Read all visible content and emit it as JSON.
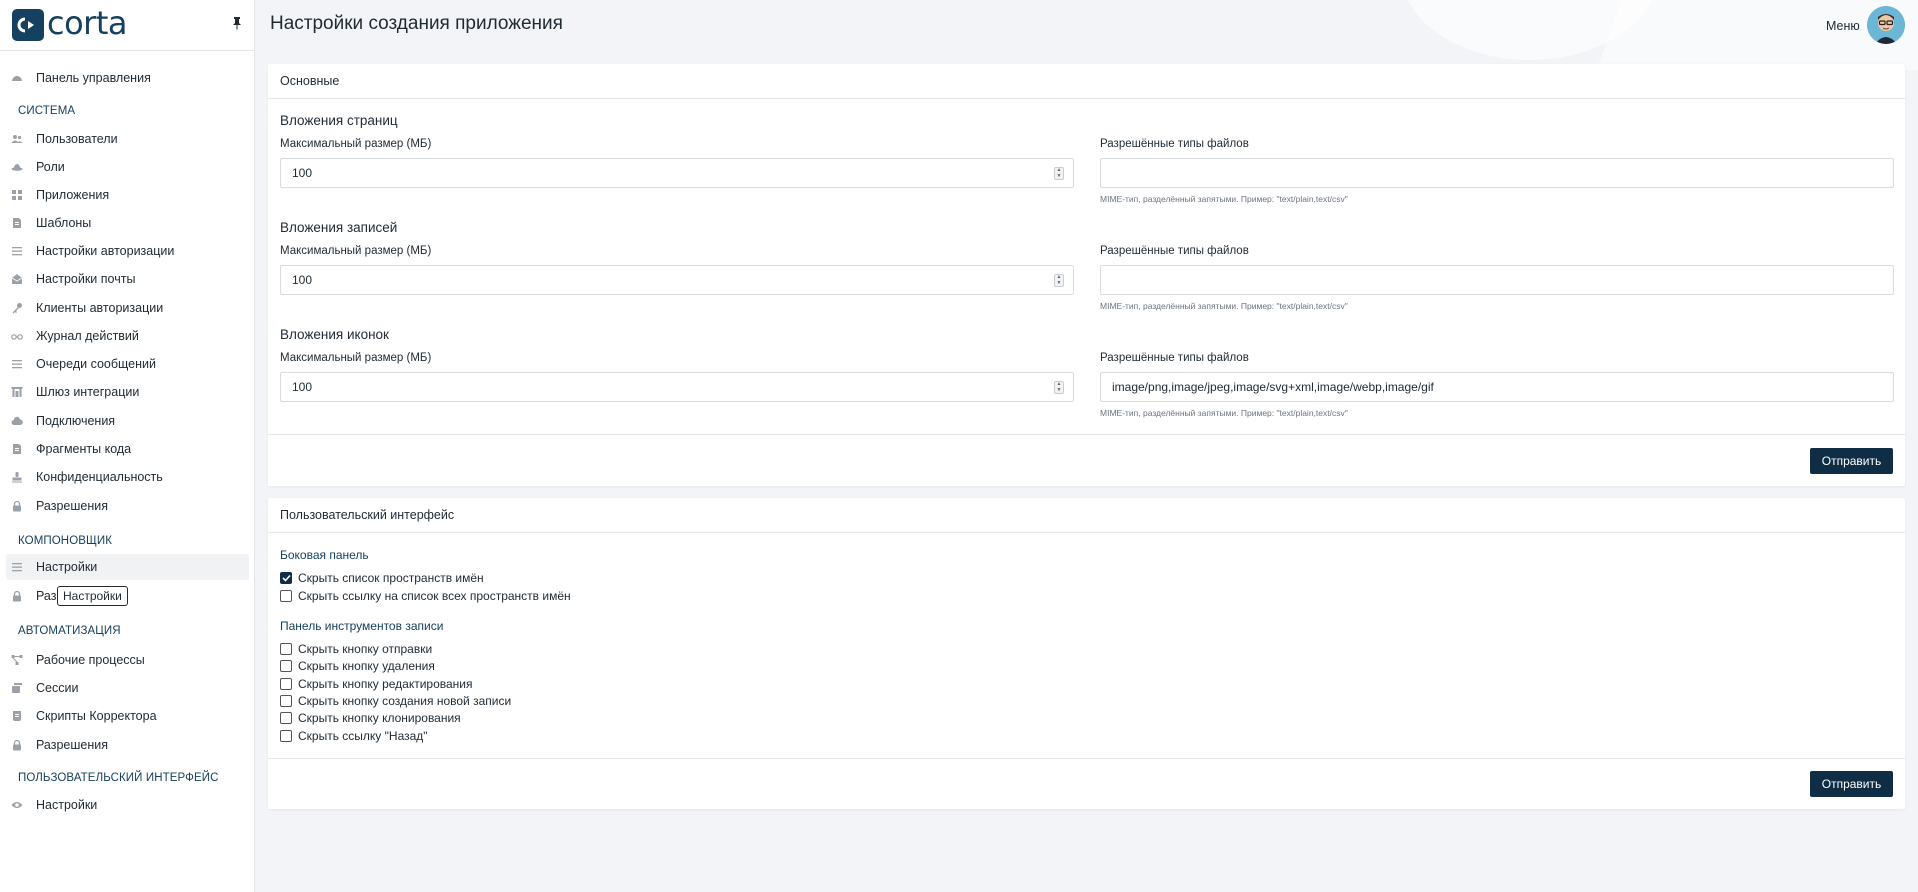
{
  "brand": {
    "name": "corta"
  },
  "header": {
    "title": "Настройки создания приложения",
    "menu_label": "Меню"
  },
  "sidebar": {
    "items": [
      {
        "label": "Панель управления",
        "icon": "dashboard-icon"
      },
      {
        "section": "СИСТЕМА"
      },
      {
        "label": "Пользователи",
        "icon": "users-icon"
      },
      {
        "label": "Роли",
        "icon": "role-icon"
      },
      {
        "label": "Приложения",
        "icon": "grid-icon"
      },
      {
        "label": "Шаблоны",
        "icon": "template-icon"
      },
      {
        "label": "Настройки авторизации",
        "icon": "list-icon"
      },
      {
        "label": "Настройки почты",
        "icon": "mail-icon"
      },
      {
        "label": "Клиенты авторизации",
        "icon": "key-icon"
      },
      {
        "label": "Журнал действий",
        "icon": "glasses-icon"
      },
      {
        "label": "Очереди сообщений",
        "icon": "queue-icon"
      },
      {
        "label": "Шлюз интеграции",
        "icon": "gateway-icon"
      },
      {
        "label": "Подключения",
        "icon": "cloud-icon"
      },
      {
        "label": "Фрагменты кода",
        "icon": "code-file-icon"
      },
      {
        "label": "Конфиденциальность",
        "icon": "stamp-icon"
      },
      {
        "label": "Разрешения",
        "icon": "lock-icon"
      },
      {
        "section": "КОМПОНОВЩИК"
      },
      {
        "label": "Настройки",
        "icon": "list-icon"
      },
      {
        "label": "Разр",
        "icon": "lock-icon"
      },
      {
        "section": "АВТОМАТИЗАЦИЯ"
      },
      {
        "label": "Рабочие процессы",
        "icon": "workflow-icon"
      },
      {
        "label": "Сессии",
        "icon": "session-icon"
      },
      {
        "label": "Скрипты Корректора",
        "icon": "script-icon"
      },
      {
        "label": "Разрешения",
        "icon": "lock-icon"
      },
      {
        "section": "ПОЛЬЗОВАТЕЛЬСКИЙ ИНТЕРФЕЙС"
      },
      {
        "label": "Настройки",
        "icon": "eye-icon"
      }
    ],
    "tooltip": "Настройки"
  },
  "main_card": {
    "header": "Основные",
    "groups": [
      {
        "title": "Вложения страниц",
        "size_label": "Максимальный размер (МБ)",
        "size_value": "100",
        "types_label": "Разрешённые типы файлов",
        "types_value": "",
        "hint": "MIME-тип, разделённый запятыми. Пример: \"text/plain,text/csv\""
      },
      {
        "title": "Вложения записей",
        "size_label": "Максимальный размер (МБ)",
        "size_value": "100",
        "types_label": "Разрешённые типы файлов",
        "types_value": "",
        "hint": "MIME-тип, разделённый запятыми. Пример: \"text/plain,text/csv\""
      },
      {
        "title": "Вложения иконок",
        "size_label": "Максимальный размер (МБ)",
        "size_value": "100",
        "types_label": "Разрешённые типы файлов",
        "types_value": "image/png,image/jpeg,image/svg+xml,image/webp,image/gif",
        "hint": "MIME-тип, разделённый запятыми. Пример: \"text/plain,text/csv\""
      }
    ],
    "submit_label": "Отправить"
  },
  "ui_card": {
    "header": "Пользовательский интерфейс",
    "sidebar_group": {
      "title": "Боковая панель",
      "options": [
        {
          "label": "Скрыть список пространств имён",
          "checked": true
        },
        {
          "label": "Скрыть ссылку на список всех пространств имён",
          "checked": false
        }
      ]
    },
    "toolbar_group": {
      "title": "Панель инструментов записи",
      "options": [
        {
          "label": "Скрыть кнопку отправки",
          "checked": false
        },
        {
          "label": "Скрыть кнопку удаления",
          "checked": false
        },
        {
          "label": "Скрыть кнопку редактирования",
          "checked": false
        },
        {
          "label": "Скрыть кнопку создания новой записи",
          "checked": false
        },
        {
          "label": "Скрыть кнопку клонирования",
          "checked": false
        },
        {
          "label": "Скрыть ссылку \"Назад\"",
          "checked": false
        }
      ]
    },
    "submit_label": "Отправить"
  },
  "colors": {
    "accent": "#0f2e46",
    "brand": "#16405f",
    "background": "#f3f4f7"
  }
}
